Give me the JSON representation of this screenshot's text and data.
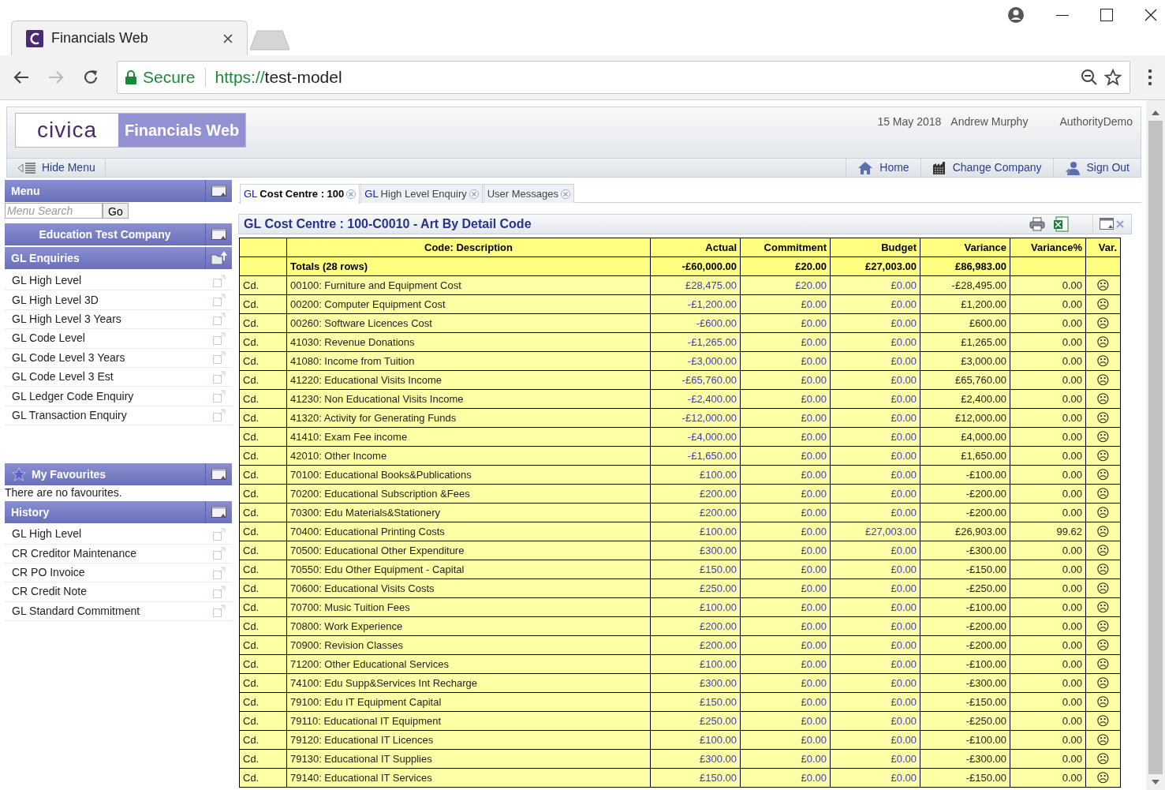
{
  "browser": {
    "tab_title": "Financials Web",
    "secure_label": "Secure",
    "url_scheme": "https://",
    "url_host": "test-model"
  },
  "header": {
    "logo": "civica",
    "product": "Financials Web",
    "date": "15 May 2018",
    "user": "Andrew Murphy",
    "company": "AuthorityDemo"
  },
  "nav": {
    "hide_menu": "Hide Menu",
    "links": [
      {
        "kind": "home",
        "label": "Home"
      },
      {
        "kind": "company",
        "label": "Change Company"
      },
      {
        "kind": "signout",
        "label": "Sign Out"
      }
    ]
  },
  "sidebar": {
    "menu_title": "Menu",
    "search": {
      "placeholder": "Menu Search",
      "button": "Go"
    },
    "company": "Education Test Company",
    "enquiries": {
      "title": "GL Enquiries",
      "items": [
        "GL High Level",
        "GL High Level 3D",
        "GL High Level 3 Years",
        "GL Code Level",
        "GL Code Level 3 Years",
        "GL Code Level 3 Est",
        "GL Ledger Code Enquiry",
        "GL Transaction Enquiry"
      ]
    },
    "favourites": {
      "title": "My Favourites",
      "empty_text": "There are no favourites."
    },
    "history": {
      "title": "History",
      "items": [
        "GL High Level",
        "CR Creditor Maintenance",
        "CR PO Invoice",
        "CR Credit Note",
        "GL Standard Commitment"
      ]
    }
  },
  "tabs": [
    {
      "prefix": "GL",
      "label": "Cost Centre : 100",
      "selected": true
    },
    {
      "prefix": "GL",
      "label": "High Level Enquiry",
      "selected": false
    },
    {
      "label": "User Messages",
      "selected": false
    }
  ],
  "panel": {
    "title": "GL Cost Centre : 100-C0010 - Art By Detail Code"
  },
  "table": {
    "columns": [
      "Code: Description",
      "Actual",
      "Commitment",
      "Budget",
      "Variance",
      "Variance%",
      "Var."
    ],
    "totals": {
      "label": "Totals (28 rows)",
      "actual": "-£60,000.00",
      "commitment": "£20.00",
      "budget": "£27,003.00",
      "variance": "£86,983.00"
    },
    "rows": [
      {
        "type": "Cd.",
        "description": "00100: Furniture and Equipment Cost",
        "actual": "£28,475.00",
        "commitment": "£20.00",
        "budget": "£0.00",
        "variance": "-£28,495.00",
        "variance_pct": "0.00",
        "var": "☹"
      },
      {
        "type": "Cd.",
        "description": "00200: Computer Equipment Cost",
        "actual": "-£1,200.00",
        "commitment": "£0.00",
        "budget": "£0.00",
        "variance": "£1,200.00",
        "variance_pct": "0.00",
        "var": "☹"
      },
      {
        "type": "Cd.",
        "description": "00260: Software Licences Cost",
        "actual": "-£600.00",
        "commitment": "£0.00",
        "budget": "£0.00",
        "variance": "£600.00",
        "variance_pct": "0.00",
        "var": "☹"
      },
      {
        "type": "Cd.",
        "description": "41030: Revenue Donations",
        "actual": "-£1,265.00",
        "commitment": "£0.00",
        "budget": "£0.00",
        "variance": "£1,265.00",
        "variance_pct": "0.00",
        "var": "☹"
      },
      {
        "type": "Cd.",
        "description": "41080: Income from Tuition",
        "actual": "-£3,000.00",
        "commitment": "£0.00",
        "budget": "£0.00",
        "variance": "£3,000.00",
        "variance_pct": "0.00",
        "var": "☹"
      },
      {
        "type": "Cd.",
        "description": "41220: Educational Visits Income",
        "actual": "-£65,760.00",
        "commitment": "£0.00",
        "budget": "£0.00",
        "variance": "£65,760.00",
        "variance_pct": "0.00",
        "var": "☹"
      },
      {
        "type": "Cd.",
        "description": "41230: Non Educational Visits Income",
        "actual": "-£2,400.00",
        "commitment": "£0.00",
        "budget": "£0.00",
        "variance": "£2,400.00",
        "variance_pct": "0.00",
        "var": "☹"
      },
      {
        "type": "Cd.",
        "description": "41320: Activity for Generating Funds",
        "actual": "-£12,000.00",
        "commitment": "£0.00",
        "budget": "£0.00",
        "variance": "£12,000.00",
        "variance_pct": "0.00",
        "var": "☹"
      },
      {
        "type": "Cd.",
        "description": "41410: Exam Fee income",
        "actual": "-£4,000.00",
        "commitment": "£0.00",
        "budget": "£0.00",
        "variance": "£4,000.00",
        "variance_pct": "0.00",
        "var": "☹"
      },
      {
        "type": "Cd.",
        "description": "42010: Other Income",
        "actual": "-£1,650.00",
        "commitment": "£0.00",
        "budget": "£0.00",
        "variance": "£1,650.00",
        "variance_pct": "0.00",
        "var": "☹"
      },
      {
        "type": "Cd.",
        "description": "70100: Educational Books&Publications",
        "actual": "£100.00",
        "commitment": "£0.00",
        "budget": "£0.00",
        "variance": "-£100.00",
        "variance_pct": "0.00",
        "var": "☹"
      },
      {
        "type": "Cd.",
        "description": "70200: Educational Subscription &Fees",
        "actual": "£200.00",
        "commitment": "£0.00",
        "budget": "£0.00",
        "variance": "-£200.00",
        "variance_pct": "0.00",
        "var": "☹"
      },
      {
        "type": "Cd.",
        "description": "70300: Edu Materials&Stationery",
        "actual": "£200.00",
        "commitment": "£0.00",
        "budget": "£0.00",
        "variance": "-£200.00",
        "variance_pct": "0.00",
        "var": "☹"
      },
      {
        "type": "Cd.",
        "description": "70400: Educational Printing Costs",
        "actual": "£100.00",
        "commitment": "£0.00",
        "budget": "£27,003.00",
        "variance": "£26,903.00",
        "variance_pct": "99.62",
        "var": "☹"
      },
      {
        "type": "Cd.",
        "description": "70500: Educational Other Expenditure",
        "actual": "£300.00",
        "commitment": "£0.00",
        "budget": "£0.00",
        "variance": "-£300.00",
        "variance_pct": "0.00",
        "var": "☹"
      },
      {
        "type": "Cd.",
        "description": "70550: Edu Other Equipment - Capital",
        "actual": "£150.00",
        "commitment": "£0.00",
        "budget": "£0.00",
        "variance": "-£150.00",
        "variance_pct": "0.00",
        "var": "☹"
      },
      {
        "type": "Cd.",
        "description": "70600: Educational Visits Costs",
        "actual": "£250.00",
        "commitment": "£0.00",
        "budget": "£0.00",
        "variance": "-£250.00",
        "variance_pct": "0.00",
        "var": "☹"
      },
      {
        "type": "Cd.",
        "description": "70700: Music Tuition Fees",
        "actual": "£100.00",
        "commitment": "£0.00",
        "budget": "£0.00",
        "variance": "-£100.00",
        "variance_pct": "0.00",
        "var": "☹"
      },
      {
        "type": "Cd.",
        "description": "70800: Work Experience",
        "actual": "£200.00",
        "commitment": "£0.00",
        "budget": "£0.00",
        "variance": "-£200.00",
        "variance_pct": "0.00",
        "var": "☹"
      },
      {
        "type": "Cd.",
        "description": "70900: Revision Classes",
        "actual": "£200.00",
        "commitment": "£0.00",
        "budget": "£0.00",
        "variance": "-£200.00",
        "variance_pct": "0.00",
        "var": "☹"
      },
      {
        "type": "Cd.",
        "description": "71200: Other Educational Services",
        "actual": "£100.00",
        "commitment": "£0.00",
        "budget": "£0.00",
        "variance": "-£100.00",
        "variance_pct": "0.00",
        "var": "☹"
      },
      {
        "type": "Cd.",
        "description": "74100: Edu Supp&Services Int Recharge",
        "actual": "£300.00",
        "commitment": "£0.00",
        "budget": "£0.00",
        "variance": "-£300.00",
        "variance_pct": "0.00",
        "var": "☹"
      },
      {
        "type": "Cd.",
        "description": "79100: Edu IT Equipment Capital",
        "actual": "£150.00",
        "commitment": "£0.00",
        "budget": "£0.00",
        "variance": "-£150.00",
        "variance_pct": "0.00",
        "var": "☹"
      },
      {
        "type": "Cd.",
        "description": "79110: Educational IT Equipment",
        "actual": "£250.00",
        "commitment": "£0.00",
        "budget": "£0.00",
        "variance": "-£250.00",
        "variance_pct": "0.00",
        "var": "☹"
      },
      {
        "type": "Cd.",
        "description": "79120: Educational IT Licences",
        "actual": "£100.00",
        "commitment": "£0.00",
        "budget": "£0.00",
        "variance": "-£100.00",
        "variance_pct": "0.00",
        "var": "☹"
      },
      {
        "type": "Cd.",
        "description": "79130: Educational IT Supplies",
        "actual": "£300.00",
        "commitment": "£0.00",
        "budget": "£0.00",
        "variance": "-£300.00",
        "variance_pct": "0.00",
        "var": "☹"
      },
      {
        "type": "Cd.",
        "description": "79140: Educational IT Services",
        "actual": "£150.00",
        "commitment": "£0.00",
        "budget": "£0.00",
        "variance": "-£150.00",
        "variance_pct": "0.00",
        "var": "☹"
      }
    ]
  }
}
